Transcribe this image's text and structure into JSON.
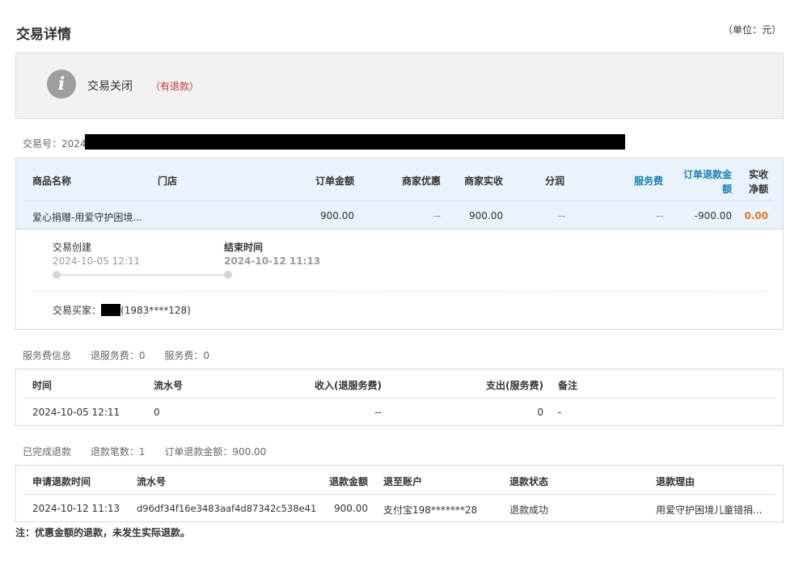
{
  "page": {
    "title": "交易详情",
    "unit_note": "（单位：元）"
  },
  "status": {
    "icon": "info-icon",
    "icon_glyph": "i",
    "text": "交易关闭",
    "refund_tag": "（有退款）"
  },
  "trade": {
    "label": "交易号：",
    "number_visible": "2024"
  },
  "order": {
    "headers": {
      "product": "商品名称",
      "store": "门店",
      "order_amount": "订单金额",
      "merchant_discount": "商家优惠",
      "merchant_received": "商家实收",
      "commission": "分润",
      "service_fee": "服务费",
      "refund_amount_1": "订单退款金",
      "refund_amount_2": "额",
      "net_1": "实收",
      "net_2": "净额"
    },
    "row": {
      "product": "爱心捐赠-用爱守护困境...",
      "store": "",
      "order_amount": "900.00",
      "merchant_discount": "--",
      "merchant_received": "900.00",
      "commission": "--",
      "service_fee": "--",
      "refund_amount": "-900.00",
      "net": "0.00"
    },
    "timeline": {
      "created_label": "交易创建",
      "created_time": "2024-10-05 12:11",
      "end_label": "结束时间",
      "end_time": "2024-10-12 11:13"
    },
    "buyer": {
      "label": "交易买家：",
      "masked_phone": "(1983****128)"
    }
  },
  "service_fee_section": {
    "title": "服务费信息",
    "refund_fee": "退服务费：0",
    "fee": "服务费：0",
    "headers": {
      "time": "时间",
      "serial": "流水号",
      "income": "收入(退服务费)",
      "expense": "支出(服务费)",
      "remark": "备注"
    },
    "row": {
      "time": "2024-10-05 12:11",
      "serial": "0",
      "income": "--",
      "expense": "0",
      "remark": "-"
    }
  },
  "refund_section": {
    "title": "已完成退款",
    "count": "退款笔数：1",
    "amount": "订单退款金额：900.00",
    "headers": {
      "time": "申请退款时间",
      "serial": "流水号",
      "amount": "退款金额",
      "account": "退至账户",
      "status": "退款状态",
      "reason": "退款理由"
    },
    "row": {
      "time": "2024-10-12 11:13",
      "serial": "d96df34f16e3483aaf4d87342c538e41",
      "amount": "900.00",
      "account": "支付宝198*******28",
      "status": "退款成功",
      "reason": "用爱守护困境儿童错捐..."
    }
  },
  "footnote": "注：优惠金额的退款，未发生实际退款。",
  "colors": {
    "accent_blue": "#1a7fb5",
    "net_orange": "#e07b2d",
    "refund_red": "#c0392b",
    "header_bg": "#e8f3fb"
  }
}
